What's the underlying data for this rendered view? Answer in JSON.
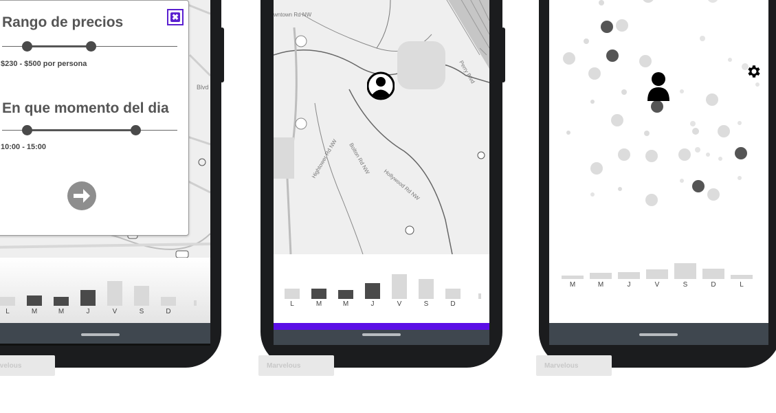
{
  "colors": {
    "accent": "#5b0fe6",
    "close_border": "#5a1fd0",
    "dark_bar": "#4a4a4a",
    "light_bar": "#d9d9d9",
    "phone_body": "#1b1c1e",
    "nav_bar": "#3f474f"
  },
  "screen1": {
    "filter_card": {
      "price_title": "Rango de precios",
      "price_value": "$230 - $500 por persona",
      "time_title": "En que momento del dia",
      "time_value": "10:00 - 15:00",
      "close_icon": "close-square-icon",
      "next_icon": "arrow-right-circle-icon"
    },
    "week_chart": {
      "labels": [
        "L",
        "M",
        "M",
        "J",
        "V",
        "S",
        "D",
        ""
      ],
      "values": [
        0.35,
        0.4,
        0.35,
        0.6,
        0.95,
        0.75,
        0.35,
        0.2
      ],
      "highlight": [
        false,
        true,
        true,
        true,
        false,
        false,
        false,
        false
      ]
    }
  },
  "screen2": {
    "avatar_icon": "user-circle-icon",
    "week_chart": {
      "labels": [
        "L",
        "M",
        "M",
        "J",
        "V",
        "S",
        "D",
        ""
      ],
      "values": [
        0.4,
        0.4,
        0.35,
        0.6,
        0.95,
        0.75,
        0.4,
        0.2
      ],
      "highlight": [
        false,
        true,
        true,
        true,
        false,
        false,
        false,
        false
      ]
    }
  },
  "screen3": {
    "person_icon": "person-icon",
    "settings_icon": "gear-icon",
    "week_chart": {
      "labels": [
        "M",
        "M",
        "J",
        "V",
        "S",
        "D",
        "L"
      ],
      "values": [
        0.2,
        0.35,
        0.4,
        0.55,
        0.9,
        0.6,
        0.25
      ]
    }
  },
  "watermark": "Marvelous"
}
